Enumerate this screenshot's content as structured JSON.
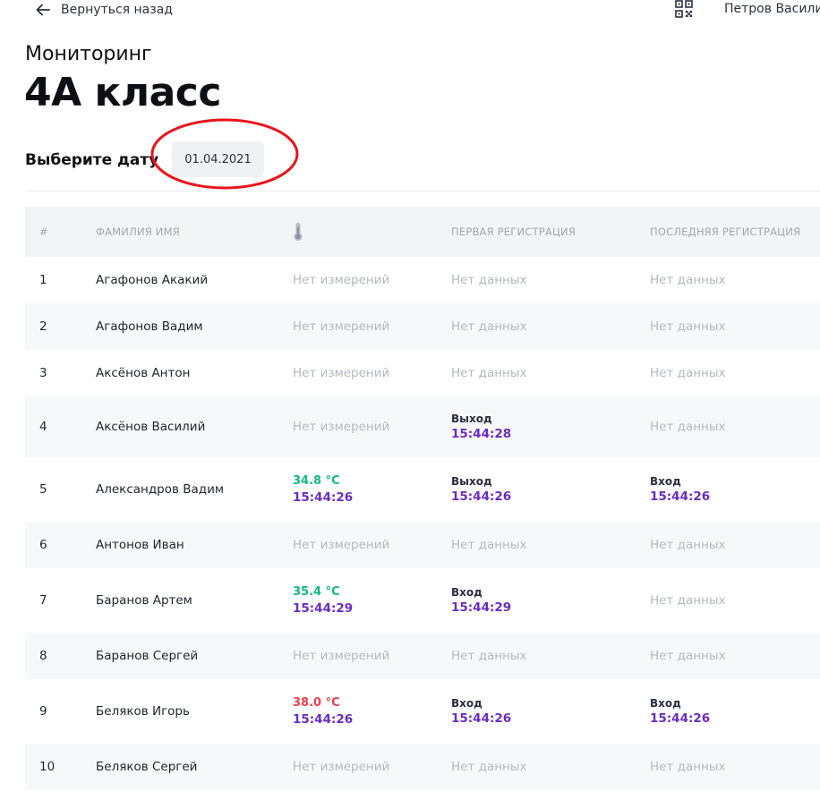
{
  "topbar": {
    "back_label": "Вернуться назад",
    "user_name": "Петров Василий"
  },
  "header": {
    "subtitle": "Мониторинг",
    "title": "4А класс"
  },
  "date_picker": {
    "label": "Выберите дату",
    "value": "01.04.2021"
  },
  "table": {
    "headers": {
      "num": "#",
      "name": "ФАМИЛИЯ ИМЯ",
      "temp_icon": "thermometer-icon",
      "first": "ПЕРВАЯ РЕГИСТРАЦИЯ",
      "last": "ПОСЛЕДНЯЯ РЕГИСТРАЦИЯ"
    },
    "rows": [
      {
        "num": "1",
        "name": "Агафонов Акакий",
        "temp": "Нет измерений",
        "first": "Нет данных",
        "last": "Нет данных"
      },
      {
        "num": "2",
        "name": "Агафонов Вадим",
        "temp": "Нет измерений",
        "first": "Нет данных",
        "last": "Нет данных"
      },
      {
        "num": "3",
        "name": "Аксёнов Антон",
        "temp": "Нет измерений",
        "first": "Нет данных",
        "last": "Нет данных"
      },
      {
        "num": "4",
        "name": "Аксёнов Василий",
        "temp": "Нет измерений",
        "first_label": "Выход",
        "first_time": "15:44:28",
        "last": "Нет данных"
      },
      {
        "num": "5",
        "name": "Александров Вадим",
        "temp_value": "34.8 °C",
        "temp_time": "15:44:26",
        "first_label": "Выход",
        "first_time": "15:44:26",
        "last_label": "Вход",
        "last_time": "15:44:26"
      },
      {
        "num": "6",
        "name": "Антонов Иван",
        "temp": "Нет измерений",
        "first": "Нет данных",
        "last": "Нет данных"
      },
      {
        "num": "7",
        "name": "Баранов Артем",
        "temp_value": "35.4 °C",
        "temp_time": "15:44:29",
        "first_label": "Вход",
        "first_time": "15:44:29",
        "last": "Нет данных"
      },
      {
        "num": "8",
        "name": "Баранов Сергей",
        "temp": "Нет измерений",
        "first": "Нет данных",
        "last": "Нет данных"
      },
      {
        "num": "9",
        "name": "Беляков Игорь",
        "temp_value": "38.0 °C",
        "temp_time": "15:44:26",
        "first_label": "Вход",
        "first_time": "15:44:26",
        "last_label": "Вход",
        "last_time": "15:44:26"
      },
      {
        "num": "10",
        "name": "Беляков Сергей",
        "temp": "Нет измерений",
        "first": "Нет данных",
        "last": "Нет данных"
      }
    ]
  },
  "colors": {
    "time": "#6a2bc4",
    "temp_normal": "#12b886",
    "temp_high": "#f03e4f",
    "muted": "#b4b8c0",
    "annotation_circle": "#e8141c"
  }
}
